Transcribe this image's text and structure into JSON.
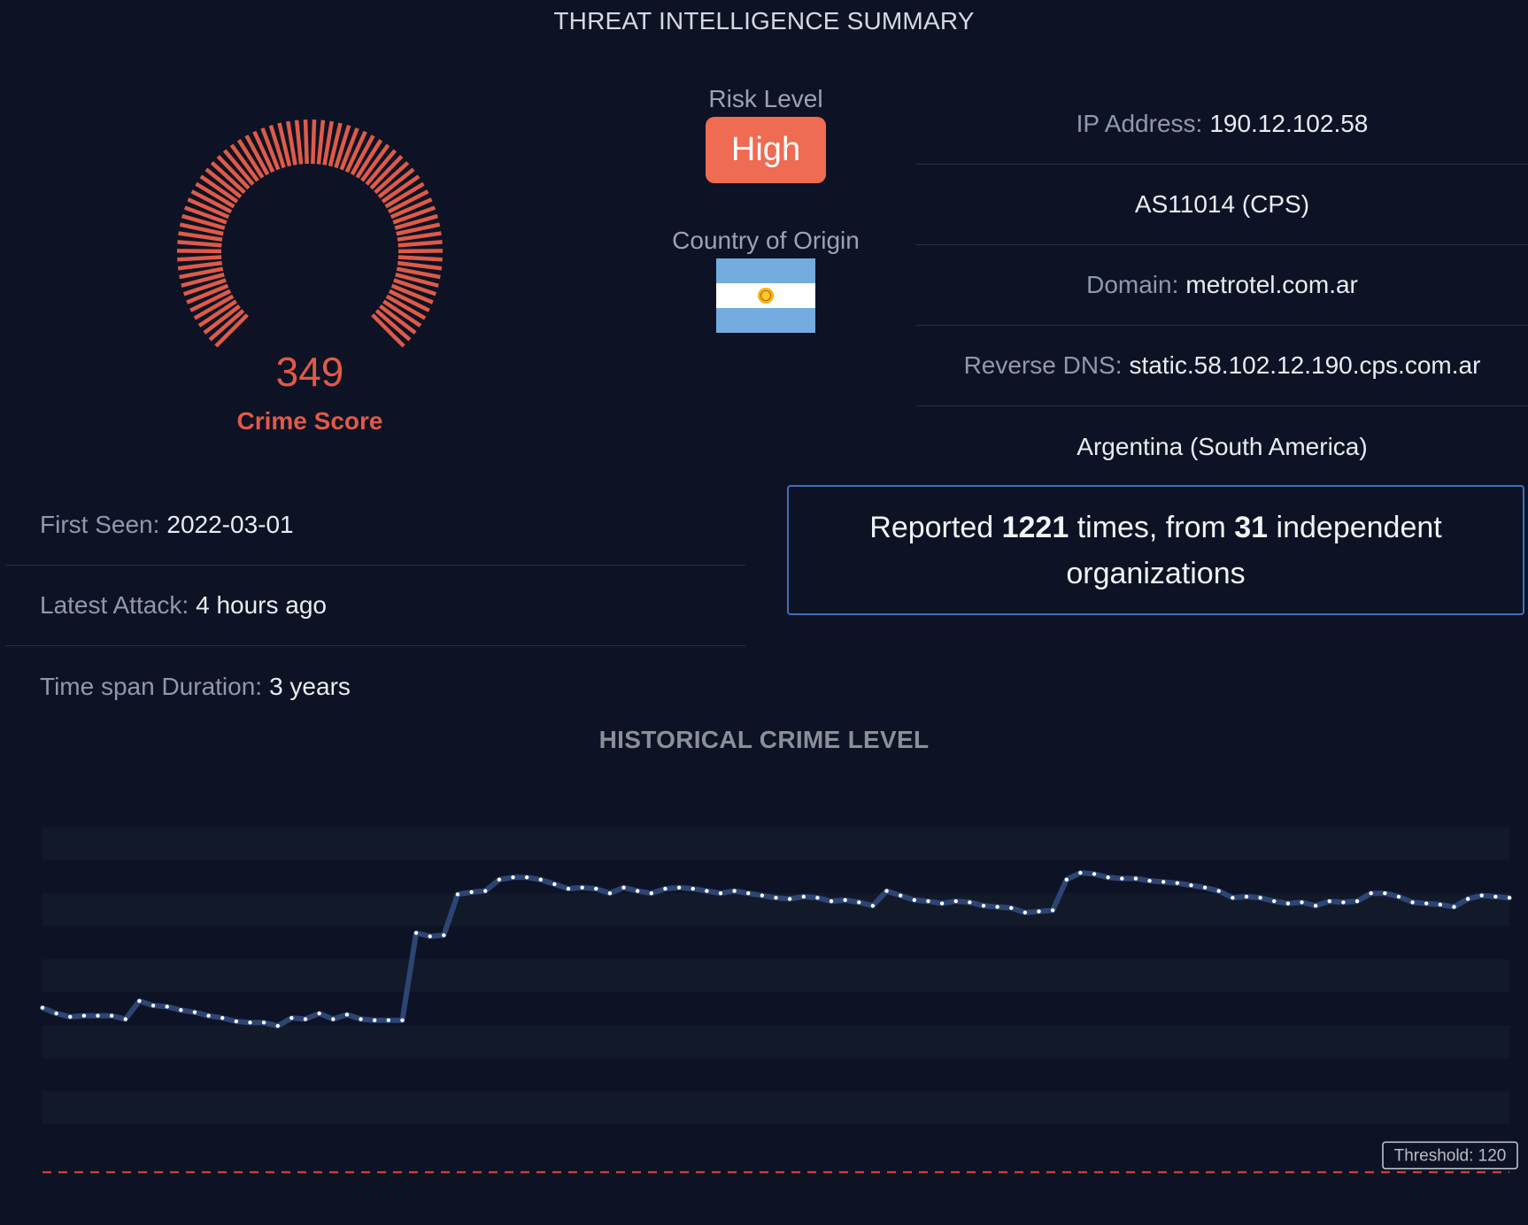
{
  "page_title": "THREAT INTELLIGENCE SUMMARY",
  "crime_score": {
    "value": "349",
    "label": "Crime Score",
    "fraction": 0.35,
    "color": "#e05a48"
  },
  "risk": {
    "title": "Risk Level",
    "value": "High",
    "color": "#ef6b52"
  },
  "country": {
    "title": "Country of Origin",
    "flag": "argentina-flag"
  },
  "info": {
    "ip_label": "IP Address:",
    "ip_value": "190.12.102.58",
    "asn": "AS11014 (CPS)",
    "domain_label": "Domain:",
    "domain_value": "metrotel.com.ar",
    "rdns_label": "Reverse DNS:",
    "rdns_value": "static.58.102.12.190.cps.com.ar",
    "location": "Argentina (South America)"
  },
  "report": {
    "prefix": "Reported",
    "count": "1221",
    "mid": "times, from",
    "orgs": "31",
    "suffix": "independent organizations"
  },
  "timeline": {
    "first_seen_label": "First Seen:",
    "first_seen_value": "2022-03-01",
    "latest_label": "Latest Attack:",
    "latest_value": "4 hours ago",
    "span_label": "Time span Duration:",
    "span_value": "3 years"
  },
  "chart_title": "HISTORICAL CRIME LEVEL",
  "chart_data": {
    "type": "line",
    "title": "HISTORICAL CRIME LEVEL",
    "ylim": [
      100,
      420
    ],
    "grid": "banded",
    "threshold": {
      "label": "Threshold: 120",
      "value": 120
    },
    "colors": {
      "line": "#2d4575",
      "point": "#ffffff",
      "threshold": "#e8473a"
    },
    "values": [
      265,
      260,
      257,
      258,
      258,
      258,
      255,
      271,
      267,
      266,
      263,
      261,
      258,
      256,
      253,
      252,
      252,
      249,
      256,
      255,
      260,
      255,
      259,
      255,
      254,
      254,
      254,
      331,
      328,
      329,
      365,
      367,
      368,
      378,
      380,
      380,
      378,
      374,
      370,
      371,
      370,
      366,
      371,
      368,
      366,
      370,
      371,
      370,
      368,
      366,
      368,
      366,
      364,
      362,
      361,
      363,
      362,
      359,
      360,
      358,
      355,
      368,
      364,
      360,
      359,
      357,
      359,
      358,
      355,
      354,
      353,
      349,
      350,
      351,
      378,
      384,
      383,
      380,
      379,
      379,
      377,
      376,
      375,
      373,
      371,
      368,
      362,
      363,
      362,
      359,
      357,
      358,
      355,
      359,
      358,
      359,
      366,
      366,
      363,
      358,
      357,
      356,
      354,
      361,
      364,
      363,
      362
    ]
  }
}
